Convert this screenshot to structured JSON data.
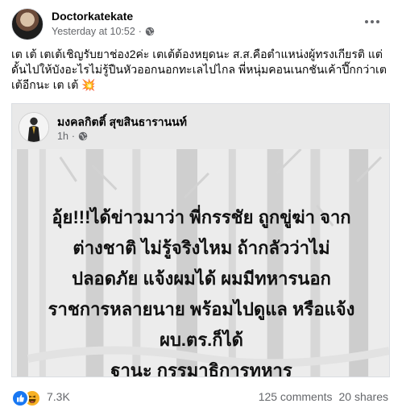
{
  "post": {
    "author": "Doctorkatekate",
    "timestamp": "Yesterday at 10:52",
    "separator": "·",
    "caption": "เต เต้ เตเต้เชิญรับยาช่อง2ค่ะ เตเต้ต้องหยุดนะ ส.ส.คือตำแหน่งผู้ทรงเกียรติ แต่ดั้นไปให้บังอะไรไม่รู้ปืนหัวออกนอกทะเลไปไกล พี่หนุ่มคอนเนกชันเค้าปึ๊กกว่าเตเต้อีกนะ เต เต้",
    "caption_emoji": "💥"
  },
  "shared_post": {
    "author": "มงคลกิตติ์ สุขสินธารานนท์",
    "timestamp": "1h",
    "separator": "·",
    "text_lines": [
      "อุ้ย!!!ได้ข่าวมาว่า พี่กรรชัย ถูกขู่ฆ่า จาก",
      "ต่างชาติ ไม่รู้จริงไหม ถ้ากลัวว่าไม่",
      "ปลอดภัย แจ้งผมได้ ผมมีทหารนอก",
      "ราชการหลายนาย พร้อมไปดูแล หรือแจ้ง",
      "ผบ.ตร.ก็ได้",
      "ฐานะ กรรมาธิการทหาร"
    ]
  },
  "footer": {
    "reaction_count": "7.3K",
    "comments": "125 comments",
    "shares": "20 shares",
    "reactions": [
      "like-icon",
      "haha-icon"
    ]
  },
  "colors": {
    "secondary_text": "#65676b",
    "like_blue": "#1877f2",
    "haha_yellow": "#f7b125"
  }
}
